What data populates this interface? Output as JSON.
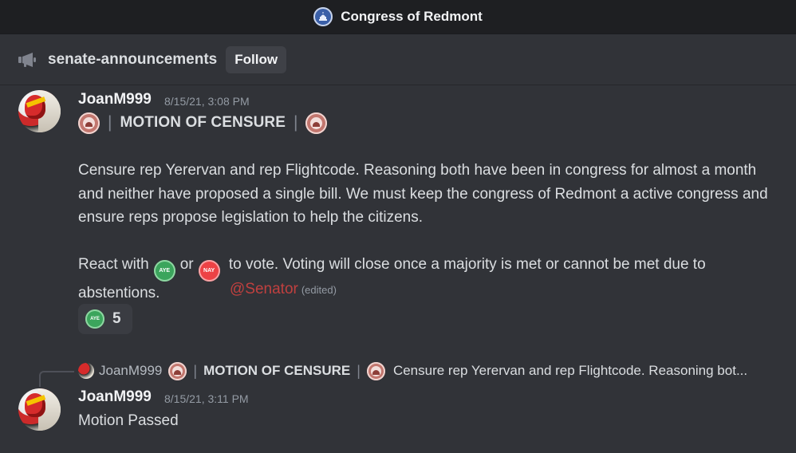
{
  "window": {
    "title": "Congress of Redmont",
    "server_icon": "capitol-seal-icon"
  },
  "channel": {
    "icon": "megaphone-icon",
    "name": "senate-announcements",
    "follow_label": "Follow"
  },
  "messages": [
    {
      "author": "JoanM999",
      "timestamp": "8/15/21, 3:08 PM",
      "heading": {
        "title": "MOTION OF CENSURE",
        "left_emoji": "congress-seal-icon",
        "right_emoji": "congress-seal-icon"
      },
      "paragraph_1": "Censure rep Yerervan and rep Flightcode. Reasoning both have been in congress for almost a month and neither have proposed a single bill. We must keep the congress of Redmont a active congress and ensure reps propose legislation to help the citizens.",
      "vote_prefix": "React with",
      "vote_or": "or",
      "vote_suffix": "to vote. Voting will close once a majority is met or cannot be met due to abstentions.",
      "aye_label": "AYE",
      "nay_label": "NAY",
      "mention": "@Senator",
      "edited_label": "(edited)",
      "reactions": [
        {
          "emoji": "aye-emoji",
          "label": "AYE",
          "count": "5"
        }
      ]
    },
    {
      "reply_to": {
        "author": "JoanM999",
        "title": "MOTION OF CENSURE",
        "preview": "Censure rep Yerervan and rep Flightcode. Reasoning bot..."
      },
      "author": "JoanM999",
      "timestamp": "8/15/21, 3:11 PM",
      "content": "Motion Passed"
    }
  ],
  "colors": {
    "background": "#313338",
    "titlebar": "#1e1f22",
    "aye": "#3ba55c",
    "nay": "#ed4245",
    "mention": "#c0403f",
    "seal": "#c2766e"
  }
}
